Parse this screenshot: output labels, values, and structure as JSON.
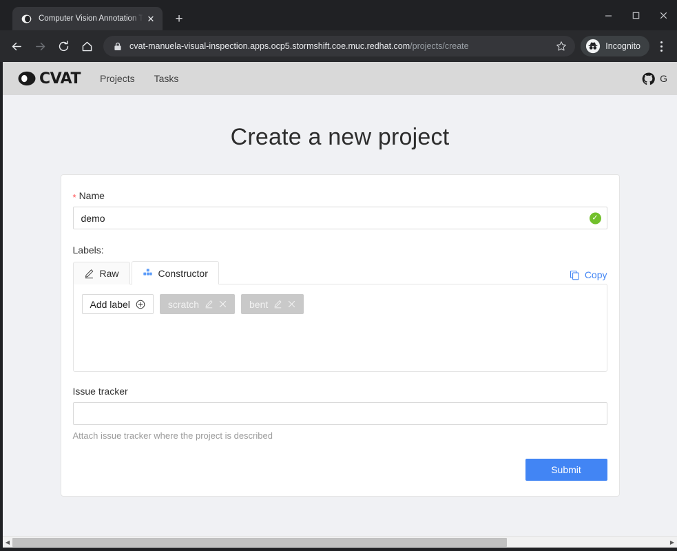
{
  "browser": {
    "tab": {
      "title": "Computer Vision Annotation To",
      "favicon_name": "cvat-favicon",
      "close_label": "✕"
    },
    "new_tab_label": "+",
    "window_controls": {
      "minimize": "—",
      "maximize": "□",
      "close": "✕"
    },
    "nav": {
      "back": "←",
      "forward": "→",
      "reload": "⟳",
      "home": "⌂"
    },
    "omnibox": {
      "url_domain": "cvat-manuela-visual-inspection.apps.ocp5.stormshift.coe.muc.redhat.com",
      "url_path": "/projects/create",
      "full_url": "cvat-manuela-visual-inspection.apps.ocp5.stormshift.coe.muc.redhat.com/projects/create",
      "lock_icon": "lock-icon",
      "bookmark_icon": "star-icon"
    },
    "incognito": {
      "label": "Incognito",
      "icon": "incognito-icon"
    },
    "menu_icon": "three-dots-menu-icon"
  },
  "app_header": {
    "logo_text": "CVAT",
    "nav_items": [
      {
        "label": "Projects"
      },
      {
        "label": "Tasks"
      }
    ],
    "github": {
      "icon": "github-icon",
      "label": "G"
    }
  },
  "page": {
    "title": "Create a new project"
  },
  "form": {
    "name": {
      "label": "Name",
      "required_marker": "*",
      "value": "demo",
      "placeholder": "",
      "valid_icon": "✓"
    },
    "labels": {
      "heading": "Labels:",
      "tabs": [
        {
          "label": "Raw",
          "icon": "edit-pencil-icon",
          "active": false
        },
        {
          "label": "Constructor",
          "icon": "build-blocks-icon",
          "active": true
        }
      ],
      "copy": {
        "label": "Copy",
        "icon": "copy-icon"
      },
      "add_label_button": {
        "label": "Add label",
        "icon": "plus-circle-icon"
      },
      "items": [
        {
          "name": "scratch",
          "edit_icon": "edit-pencil-icon",
          "delete_icon": "close-x-icon"
        },
        {
          "name": "bent",
          "edit_icon": "edit-pencil-icon",
          "delete_icon": "close-x-icon"
        }
      ]
    },
    "issue_tracker": {
      "label": "Issue tracker",
      "value": "",
      "placeholder": "",
      "hint": "Attach issue tracker where the project is described"
    },
    "submit": {
      "label": "Submit"
    }
  },
  "colors": {
    "accent_blue": "#4285f4",
    "valid_green": "#72c02c",
    "required_red": "#ff4d4f",
    "page_bg": "#f0f1f4",
    "header_bg": "#d9d9d9",
    "tag_grey": "#c9c9c9"
  },
  "scrollbar": {
    "left_arrow": "◀",
    "right_arrow": "▶",
    "thumb_ratio": "75%"
  }
}
